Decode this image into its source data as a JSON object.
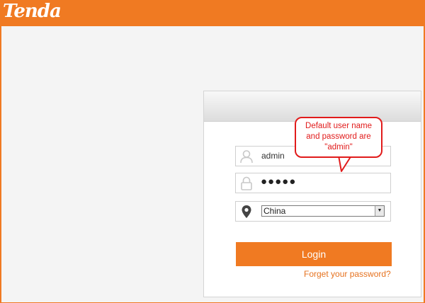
{
  "header": {
    "logo_text": "Tenda",
    "brand_color": "#f07a22"
  },
  "login": {
    "username_value": "admin",
    "password_value": "●●●●●",
    "region_selected": "China",
    "login_label": "Login",
    "forget_label": "Forget your password?"
  },
  "callout": {
    "line1": "Default user name",
    "line2": "and password are",
    "line3": "\"admin\"",
    "color": "#e11b1b"
  },
  "icons": {
    "user": "user-icon",
    "lock": "lock-icon",
    "location": "location-pin-icon",
    "dropdown": "chevron-down-icon"
  }
}
